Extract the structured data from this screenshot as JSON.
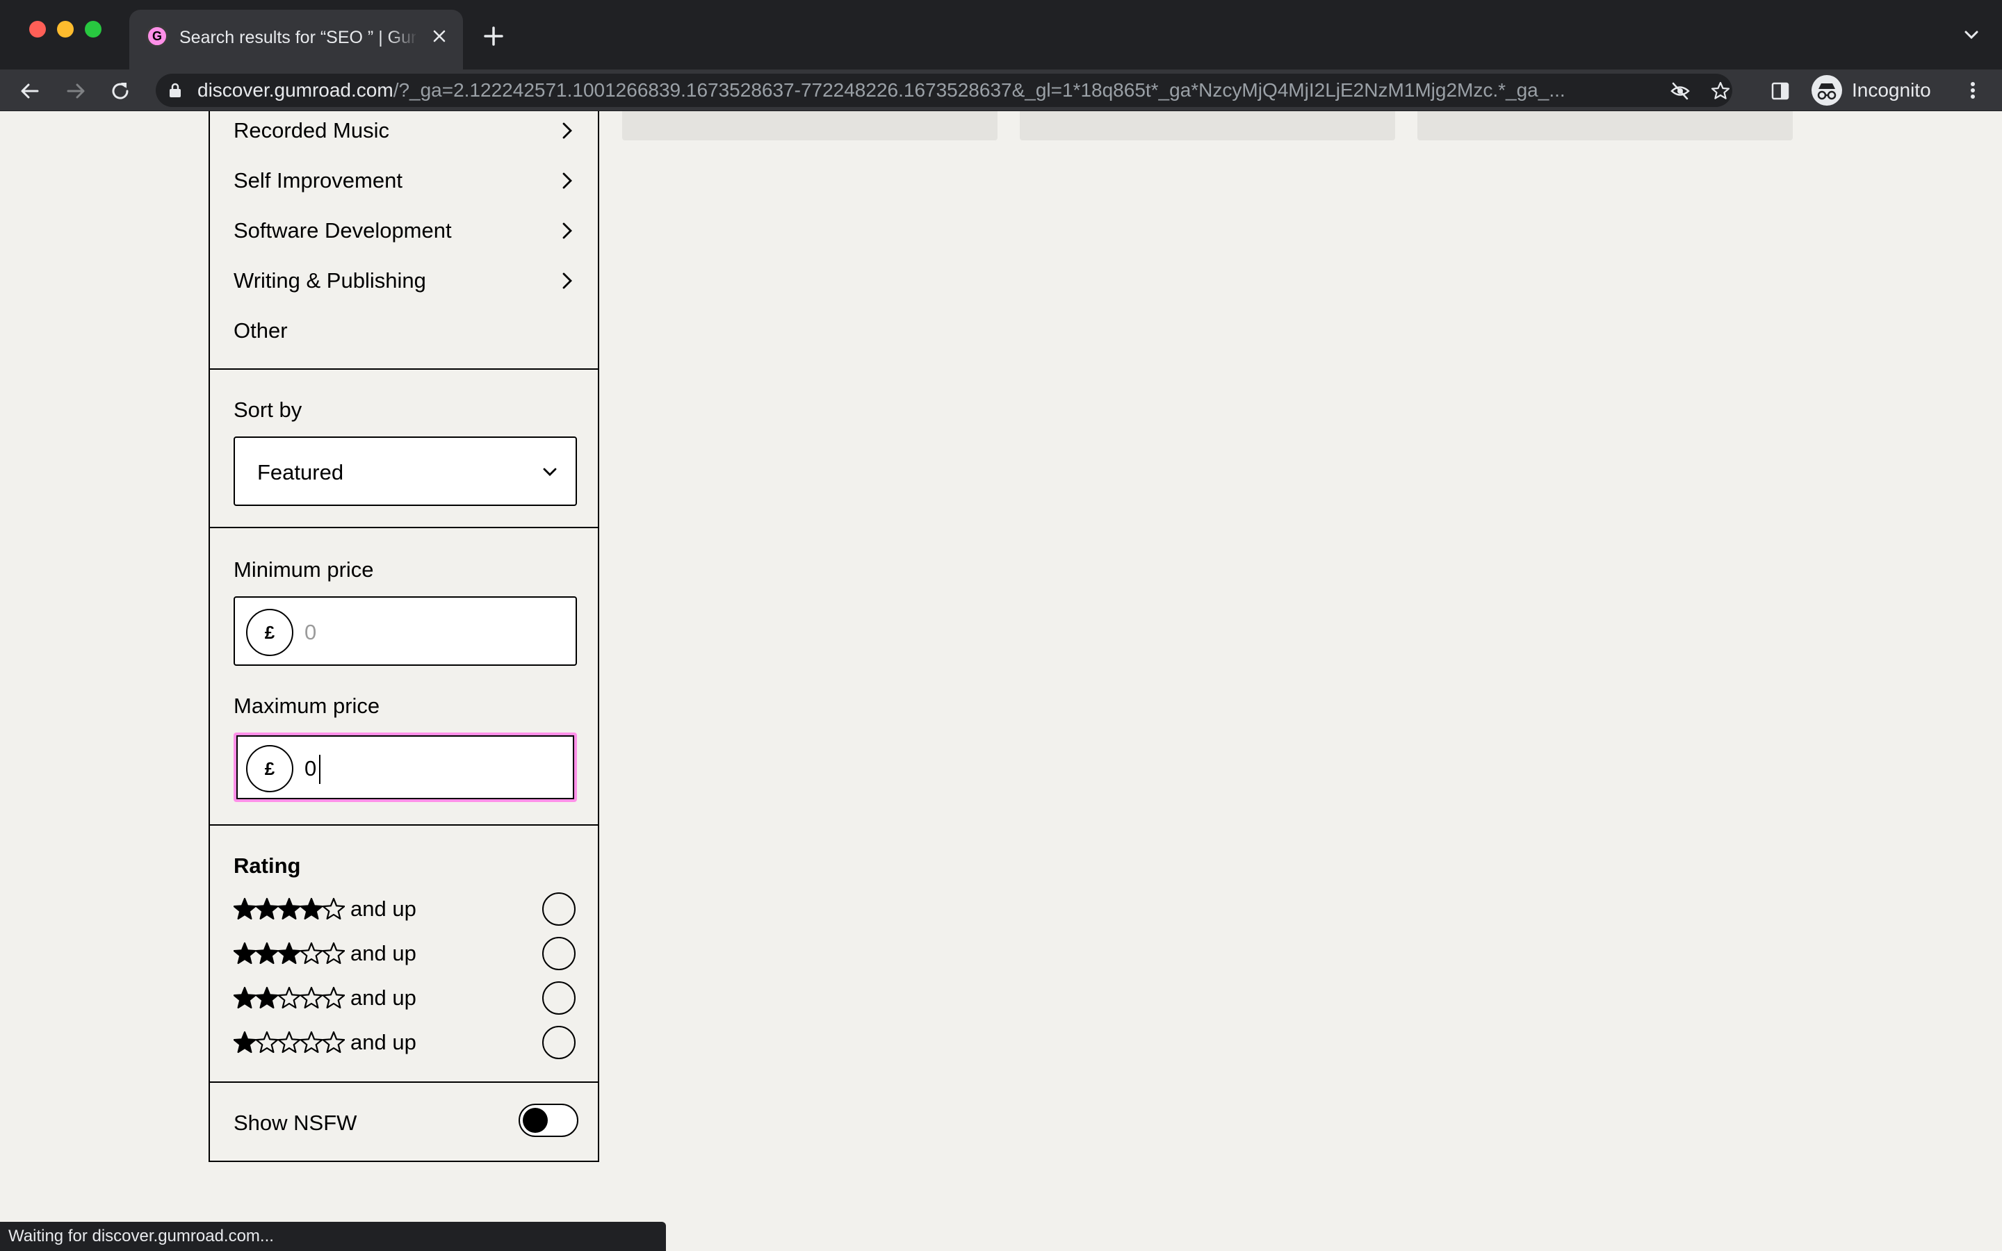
{
  "browser": {
    "tab_title": "Search results for “SEO ” | Gumroad",
    "tab_favicon_letter": "G",
    "url_host": "discover.gumroad.com",
    "url_rest": "/?_ga=2.122242571.1001266839.1673528637-772248226.1673528637&_gl=1*18q865t*_ga*NzcyMjQ4MjI2LjE2NzM1Mjg2Mzc.*_ga_...",
    "profile_label": "Incognito",
    "status_text": "Waiting for discover.gumroad.com..."
  },
  "filters": {
    "categories": [
      {
        "label": "Recorded Music",
        "has_children": true
      },
      {
        "label": "Self Improvement",
        "has_children": true
      },
      {
        "label": "Software Development",
        "has_children": true
      },
      {
        "label": "Writing & Publishing",
        "has_children": true
      },
      {
        "label": "Other",
        "has_children": false
      }
    ],
    "sort": {
      "label": "Sort by",
      "value": "Featured"
    },
    "min_price": {
      "label": "Minimum price",
      "currency": "£",
      "placeholder": "0",
      "value": ""
    },
    "max_price": {
      "label": "Maximum price",
      "currency": "£",
      "placeholder": "0",
      "value": "0"
    },
    "rating": {
      "label": "Rating",
      "options": [
        {
          "stars": 4,
          "text": "and up"
        },
        {
          "stars": 3,
          "text": "and up"
        },
        {
          "stars": 2,
          "text": "and up"
        },
        {
          "stars": 1,
          "text": "and up"
        }
      ]
    },
    "nsfw": {
      "label": "Show NSFW",
      "on": false
    }
  },
  "colors": {
    "accent": "#ff90e8",
    "background": "#f2f1ed",
    "skeleton": "#e4e3df"
  }
}
